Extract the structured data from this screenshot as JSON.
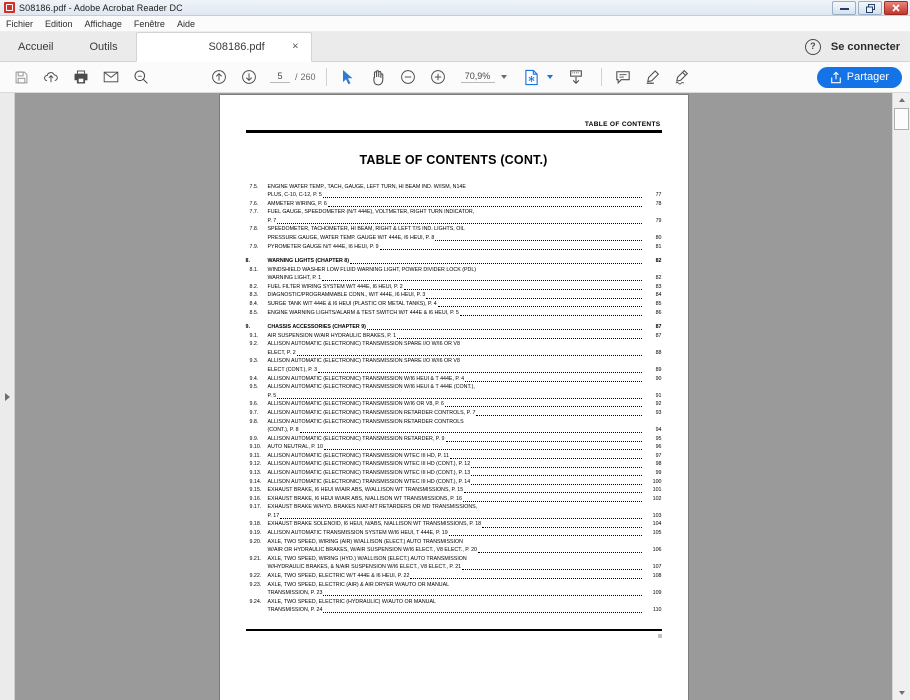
{
  "window": {
    "title": "S08186.pdf - Adobe Acrobat Reader DC",
    "app_icon": "pdf-file-icon",
    "minimize": "–",
    "restore": "❐",
    "close": "✕"
  },
  "menubar": {
    "items": [
      {
        "label": "Fichier",
        "name": "menu-fichier"
      },
      {
        "label": "Edition",
        "name": "menu-edition"
      },
      {
        "label": "Affichage",
        "name": "menu-affichage"
      },
      {
        "label": "Fenêtre",
        "name": "menu-fenetre"
      },
      {
        "label": "Aide",
        "name": "menu-aide"
      }
    ]
  },
  "tabbar": {
    "home": "Accueil",
    "tools": "Outils",
    "document_tab": "S08186.pdf",
    "document_tab_close": "×",
    "help_icon": "?",
    "sign_in": "Se connecter"
  },
  "toolbar": {
    "save_icon": "save-icon",
    "upload_icon": "upload-cloud-icon",
    "print_icon": "print-icon",
    "email_icon": "email-icon",
    "search_icon": "search-icon",
    "prev_page_icon": "arrow-up-circle-icon",
    "next_page_icon": "arrow-down-circle-icon",
    "page_current": "5",
    "page_separator": "/",
    "page_total": "260",
    "select_tool_icon": "cursor-icon",
    "hand_tool_icon": "hand-icon",
    "zoom_out_icon": "minus-circle-icon",
    "zoom_in_icon": "plus-circle-icon",
    "zoom_level": "70,9%",
    "page_fit_icon": "page-fit-icon",
    "scroll_mode_icon": "scroll-mode-icon",
    "comment_icon": "comment-icon",
    "highlight_icon": "highlighter-icon",
    "sign_icon": "signature-icon",
    "share_label": "Partager",
    "share_icon": "share-icon",
    "accent_color": "#1473e6"
  },
  "sidebar": {
    "expand_icon": "chevron-right-icon"
  },
  "scrollbar": {
    "up_icon": "scroll-up-arrow-icon",
    "down_icon": "scroll-down-arrow-icon"
  },
  "document": {
    "running_header": "TABLE OF CONTENTS",
    "title": "TABLE OF CONTENTS (CONT.)",
    "entries": [
      {
        "num": "7.5.",
        "lines": [
          {
            "text": "ENGINE WATER TEMP., TACH, GAUGE, LEFT TURN, HI BEAM IND. W/ISM, N14E",
            "dots": false,
            "page": ""
          },
          {
            "text": "PLUS, C-10, C-12, P. 5",
            "dots": true,
            "page": "77"
          }
        ],
        "chapter": false
      },
      {
        "num": "7.6.",
        "lines": [
          {
            "text": "AMMETER WIRING, P. 6",
            "dots": true,
            "page": "78"
          }
        ],
        "chapter": false
      },
      {
        "num": "7.7.",
        "lines": [
          {
            "text": "FUEL GAUGE, SPEEDOMETER (N/T 444E), VOLTMETER, RIGHT TURN INDICATOR,",
            "dots": false,
            "page": ""
          },
          {
            "text": "P. 7",
            "dots": true,
            "page": "79"
          }
        ],
        "chapter": false
      },
      {
        "num": "7.8.",
        "lines": [
          {
            "text": "SPEEDOMETER, TACHOMETER, HI BEAM, RIGHT & LEFT T/S IND. LIGHTS, OIL",
            "dots": false,
            "page": ""
          },
          {
            "text": "PRESSURE GAUGE, WATER TEMP. GAUGE W/T 444E, I6 HEUI, P. 8",
            "dots": true,
            "page": "80"
          }
        ],
        "chapter": false
      },
      {
        "num": "7.9.",
        "lines": [
          {
            "text": "PYROMETER GAUGE N/T 444E, I6 HEUI, P. 9",
            "dots": true,
            "page": "81"
          }
        ],
        "chapter": false
      },
      {
        "num": "8.",
        "lines": [
          {
            "text": "WARNING LIGHTS (CHAPTER 8)",
            "dots": true,
            "page": "82"
          }
        ],
        "chapter": true
      },
      {
        "num": "8.1.",
        "lines": [
          {
            "text": "WINDSHIELD WASHER LOW FLUID WARNING LIGHT, POWER DIVIDER LOCK (PDL)",
            "dots": false,
            "page": ""
          },
          {
            "text": "WARNING LIGHT, P. 1",
            "dots": true,
            "page": "82"
          }
        ],
        "chapter": false
      },
      {
        "num": "8.2.",
        "lines": [
          {
            "text": "FUEL FILTER WIRING SYSTEM W/T 444E, I6 HEUI, P. 2",
            "dots": true,
            "page": "83"
          }
        ],
        "chapter": false
      },
      {
        "num": "8.3.",
        "lines": [
          {
            "text": "DIAGNOSTIC/PROGRAMMABLE CONN., W/T 444E, I6 HEUI, P. 3",
            "dots": true,
            "page": "84"
          }
        ],
        "chapter": false
      },
      {
        "num": "8.4.",
        "lines": [
          {
            "text": "SURGE TANK W/T 444E & I6 HEUI (PLASTIC OR METAL TANKS), P. 4",
            "dots": true,
            "page": "85"
          }
        ],
        "chapter": false
      },
      {
        "num": "8.5.",
        "lines": [
          {
            "text": "ENGINE WARNING LIGHTS/ALARM & TEST SWITCH W/T 444E & I6 HEUI, P. 5",
            "dots": true,
            "page": "86"
          }
        ],
        "chapter": false
      },
      {
        "num": "9.",
        "lines": [
          {
            "text": "CHASSIS ACCESSORIES (CHAPTER 9)",
            "dots": true,
            "page": "87"
          }
        ],
        "chapter": true
      },
      {
        "num": "9.1.",
        "lines": [
          {
            "text": "AIR SUSPENSION W/AIR HYDRAULIC BRAKES, P. 1",
            "dots": true,
            "page": "87"
          }
        ],
        "chapter": false
      },
      {
        "num": "9.2.",
        "lines": [
          {
            "text": "ALLISON AUTOMATIC (ELECTRONIC) TRANSMISSION SPARE I/O W/I6 OR V8",
            "dots": false,
            "page": ""
          },
          {
            "text": "ELECT, P. 2",
            "dots": true,
            "page": "88"
          }
        ],
        "chapter": false
      },
      {
        "num": "9.3.",
        "lines": [
          {
            "text": "ALLISON AUTOMATIC (ELECTRONIC) TRANSMISSION SPARE I/O W/I6 OR V8",
            "dots": false,
            "page": ""
          },
          {
            "text": "ELECT (CONT.), P. 3",
            "dots": true,
            "page": "89"
          }
        ],
        "chapter": false
      },
      {
        "num": "9.4.",
        "lines": [
          {
            "text": "ALLISON AUTOMATIC (ELECTRONIC) TRANSMISSION W/I6 HEUI & T 444E, P. 4",
            "dots": true,
            "page": "90"
          }
        ],
        "chapter": false
      },
      {
        "num": "9.5.",
        "lines": [
          {
            "text": "ALLISON AUTOMATIC (ELECTRONIC) TRANSMISSION W/I6 HEUI & T 444E (CONT.),",
            "dots": false,
            "page": ""
          },
          {
            "text": "P. 5",
            "dots": true,
            "page": "91"
          }
        ],
        "chapter": false
      },
      {
        "num": "9.6.",
        "lines": [
          {
            "text": "ALLISON AUTOMATIC (ELECTRONIC) TRANSMISSION W/I6 OR V8, P. 6",
            "dots": true,
            "page": "92"
          }
        ],
        "chapter": false
      },
      {
        "num": "9.7.",
        "lines": [
          {
            "text": "ALLISON AUTOMATIC (ELECTRONIC) TRANSMISSION RETARDER CONTROLS, P. 7",
            "dots": true,
            "page": "93"
          }
        ],
        "chapter": false
      },
      {
        "num": "9.8.",
        "lines": [
          {
            "text": "ALLISON AUTOMATIC (ELECTRONIC) TRANSMISSION RETARDER CONTROLS",
            "dots": false,
            "page": ""
          },
          {
            "text": "(CONT.), P. 8",
            "dots": true,
            "page": "94"
          }
        ],
        "chapter": false
      },
      {
        "num": "9.9.",
        "lines": [
          {
            "text": "ALLISON AUTOMATIC (ELECTRONIC) TRANSMISSION RETARDER, P. 9",
            "dots": true,
            "page": "95"
          }
        ],
        "chapter": false
      },
      {
        "num": "9.10.",
        "lines": [
          {
            "text": "AUTO NEUTRAL, P. 10",
            "dots": true,
            "page": "96"
          }
        ],
        "chapter": false
      },
      {
        "num": "9.11.",
        "lines": [
          {
            "text": "ALLISON AUTOMATIC (ELECTRONIC) TRANSMISSION WTEC III HD, P. 11",
            "dots": true,
            "page": "97"
          }
        ],
        "chapter": false
      },
      {
        "num": "9.12.",
        "lines": [
          {
            "text": "ALLISON AUTOMATIC (ELECTRONIC) TRANSMISSION WTEC III HD (CONT.), P. 12",
            "dots": true,
            "page": "98"
          }
        ],
        "chapter": false
      },
      {
        "num": "9.13.",
        "lines": [
          {
            "text": "ALLISON AUTOMATIC (ELECTRONIC) TRANSMISSION WTEC III HD (CONT.), P. 13",
            "dots": true,
            "page": "99"
          }
        ],
        "chapter": false
      },
      {
        "num": "9.14.",
        "lines": [
          {
            "text": "ALLISON AUTOMATIC (ELECTRONIC) TRANSMISSION WTEC III HD (CONT.), P. 14",
            "dots": true,
            "page": "100"
          }
        ],
        "chapter": false
      },
      {
        "num": "9.15.",
        "lines": [
          {
            "text": "EXHAUST BRAKE, I6 HEUI W/AIR ABS, W/ALLISON WT TRANSMISSIONS, P. 15",
            "dots": true,
            "page": "101"
          }
        ],
        "chapter": false
      },
      {
        "num": "9.16.",
        "lines": [
          {
            "text": "EXHAUST BRAKE, I6 HEUI W/AIR ABS, N/ALLISON WT TRANSMISSIONS, P. 16",
            "dots": true,
            "page": "102"
          }
        ],
        "chapter": false
      },
      {
        "num": "9.17.",
        "lines": [
          {
            "text": "EXHAUST BRAKE W/HYD. BRAKES N/AT-MT RETARDERS OR MD TRANSMISSIONS,",
            "dots": false,
            "page": ""
          },
          {
            "text": "P. 17",
            "dots": true,
            "page": "103"
          }
        ],
        "chapter": false
      },
      {
        "num": "9.18.",
        "lines": [
          {
            "text": "EXHAUST BRAKE SOLENOID, I6 HEUI, N/ABS, N/ALLISON WT TRANSMISSIONS, P. 18",
            "dots": true,
            "page": "104"
          }
        ],
        "chapter": false
      },
      {
        "num": "9.19.",
        "lines": [
          {
            "text": "ALLISON AUTOMATIC TRANSMISSION SYSTEM W/I6 HEUI, T 444E, P. 19",
            "dots": true,
            "page": "105"
          }
        ],
        "chapter": false
      },
      {
        "num": "9.20.",
        "lines": [
          {
            "text": "AXLE, TWO SPEED, WIRING (AIR) W/ALLISON (ELECT.) AUTO TRANSMISSION",
            "dots": false,
            "page": ""
          },
          {
            "text": "W/AIR OR HYDRAULIC BRAKES, W/AIR SUSPENSION W/I6 ELECT., V8 ELECT., P. 20",
            "dots": true,
            "page": "106"
          }
        ],
        "chapter": false
      },
      {
        "num": "9.21.",
        "lines": [
          {
            "text": "AXLE, TWO SPEED, WIRING (HYD.) W/ALLISON (ELECT.) AUTO TRANSMISSION",
            "dots": false,
            "page": ""
          },
          {
            "text": "W/HYDRAULIC BRAKES, & N/AIR SUSPENSION W/I6 ELECT., V8 ELECT., P. 21",
            "dots": true,
            "page": "107"
          }
        ],
        "chapter": false
      },
      {
        "num": "9.22.",
        "lines": [
          {
            "text": "AXLE, TWO SPEED, ELECTRIC W/T 444E & I6 HEUI, P. 22",
            "dots": true,
            "page": "108"
          }
        ],
        "chapter": false
      },
      {
        "num": "9.23.",
        "lines": [
          {
            "text": "AXLE, TWO SPEED, ELECTRIC (AIR) & AIR DRYER W/AUTO OR MANUAL",
            "dots": false,
            "page": ""
          },
          {
            "text": "TRANSMISSION, P. 23",
            "dots": true,
            "page": "109"
          }
        ],
        "chapter": false
      },
      {
        "num": "9.24.",
        "lines": [
          {
            "text": "AXLE, TWO SPEED, ELECTRIC (HYDRAULIC) W/AUTO OR MANUAL",
            "dots": false,
            "page": ""
          },
          {
            "text": "TRANSMISSION, P. 24",
            "dots": true,
            "page": "110"
          }
        ],
        "chapter": false
      }
    ]
  }
}
